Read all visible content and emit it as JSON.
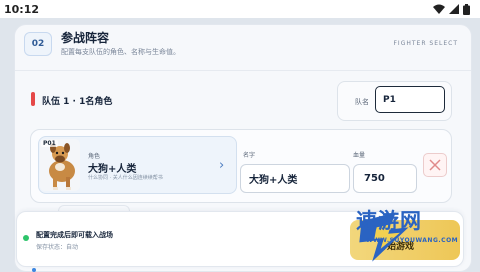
{
  "status_bar": {
    "time": "10:12"
  },
  "header": {
    "step": "02",
    "title": "参战阵容",
    "subtitle": "配置每支队伍的角色、名称与生命值。",
    "tag": "FIGHTER SELECT"
  },
  "team": {
    "label": "队伍 1 · 1名角色",
    "name_label": "队名",
    "name_value": "P1",
    "accent_color": "#e54848"
  },
  "member": {
    "portrait_tag": "P01",
    "role_caption": "角色",
    "role_name": "大狗+人类",
    "role_desc": "什么协同 · 关人什么因连续续帮书",
    "name_label": "名字",
    "name_value": "大狗+人类",
    "hp_label": "血量",
    "hp_value": "750"
  },
  "footer": {
    "ready_text": "配置完成后即可载入战场",
    "save_status": "保存状态：自动",
    "start_label": "开始游戏"
  },
  "watermark": {
    "text": "速游网",
    "url": "WWW.SUYOUWANG.COM"
  }
}
